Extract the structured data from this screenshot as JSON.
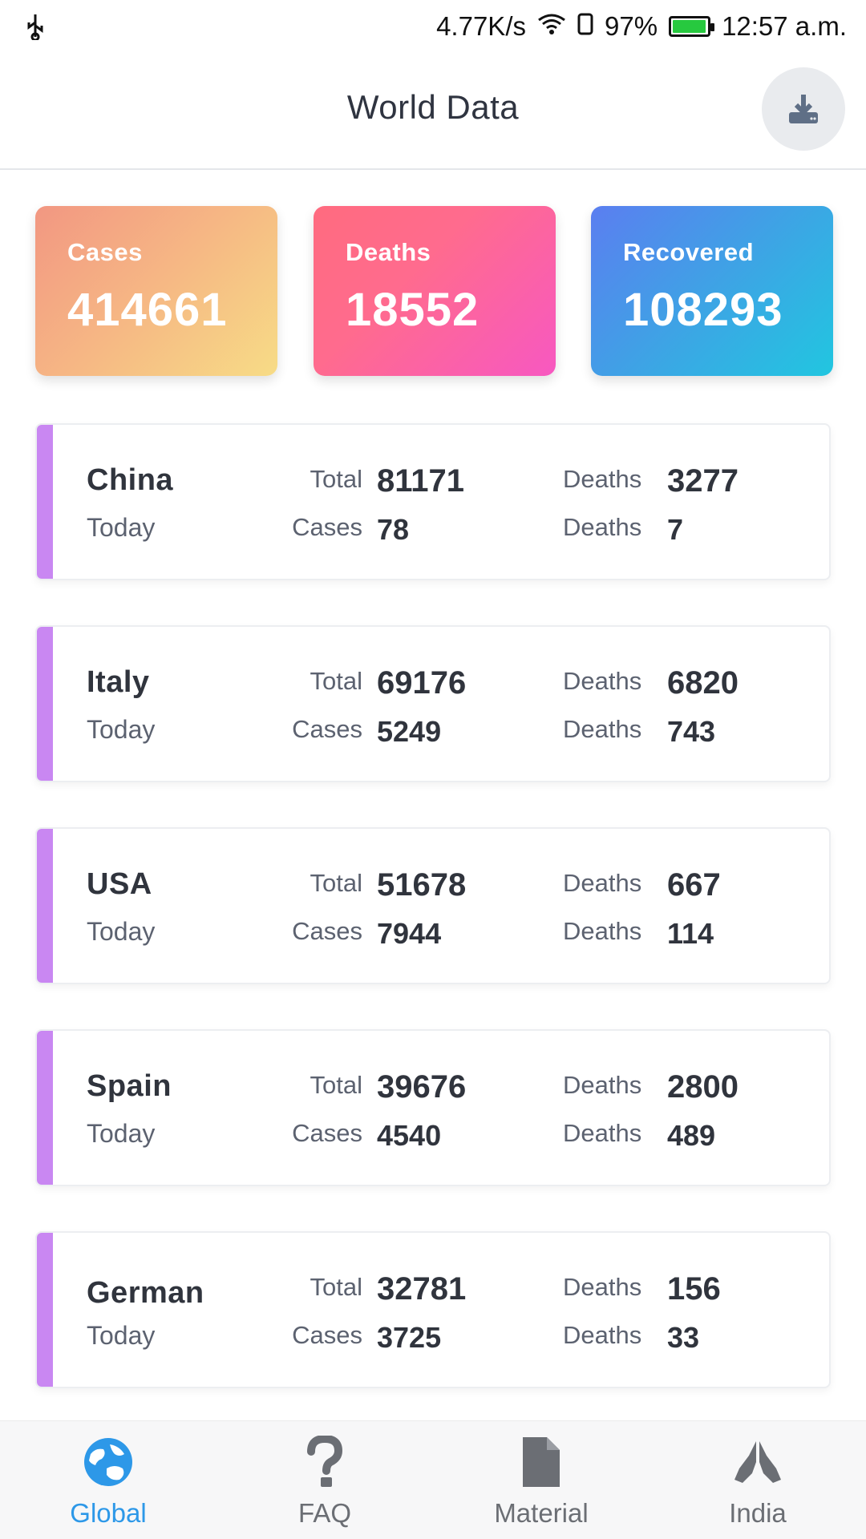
{
  "status_bar": {
    "speed": "4.77K/s",
    "battery_pct": "97%",
    "battery_level": 0.97,
    "time": "12:57 a.m."
  },
  "header": {
    "title": "World Data",
    "download_icon": "download-icon"
  },
  "stats": {
    "cases": {
      "label": "Cases",
      "value": "414661"
    },
    "deaths": {
      "label": "Deaths",
      "value": "18552"
    },
    "recovered": {
      "label": "Recovered",
      "value": "108293"
    }
  },
  "countries": [
    {
      "name": "China",
      "today": "Today",
      "total_label": "Total",
      "total": "81171",
      "deaths_label": "Deaths",
      "deaths": "3277",
      "cases_label": "Cases",
      "cases_today": "78",
      "deaths_today_label": "Deaths",
      "deaths_today": "7"
    },
    {
      "name": "Italy",
      "today": "Today",
      "total_label": "Total",
      "total": "69176",
      "deaths_label": "Deaths",
      "deaths": "6820",
      "cases_label": "Cases",
      "cases_today": "5249",
      "deaths_today_label": "Deaths",
      "deaths_today": "743"
    },
    {
      "name": "USA",
      "today": "Today",
      "total_label": "Total",
      "total": "51678",
      "deaths_label": "Deaths",
      "deaths": "667",
      "cases_label": "Cases",
      "cases_today": "7944",
      "deaths_today_label": "Deaths",
      "deaths_today": "114"
    },
    {
      "name": "Spain",
      "today": "Today",
      "total_label": "Total",
      "total": "39676",
      "deaths_label": "Deaths",
      "deaths": "2800",
      "cases_label": "Cases",
      "cases_today": "4540",
      "deaths_today_label": "Deaths",
      "deaths_today": "489"
    },
    {
      "name": "German",
      "today": "Today",
      "total_label": "Total",
      "total": "32781",
      "deaths_label": "Deaths",
      "deaths": "156",
      "cases_label": "Cases",
      "cases_today": "3725",
      "deaths_today_label": "Deaths",
      "deaths_today": "33"
    }
  ],
  "bottom_nav": {
    "active_color": "#2d98e8",
    "items": [
      {
        "label": "Global",
        "icon": "globe-icon",
        "active": true
      },
      {
        "label": "FAQ",
        "icon": "question-icon",
        "active": false
      },
      {
        "label": "Material",
        "icon": "document-icon",
        "active": false
      },
      {
        "label": "India",
        "icon": "praying-hands-icon",
        "active": false
      }
    ]
  },
  "colors": {
    "country_accent": "#c987f2"
  }
}
